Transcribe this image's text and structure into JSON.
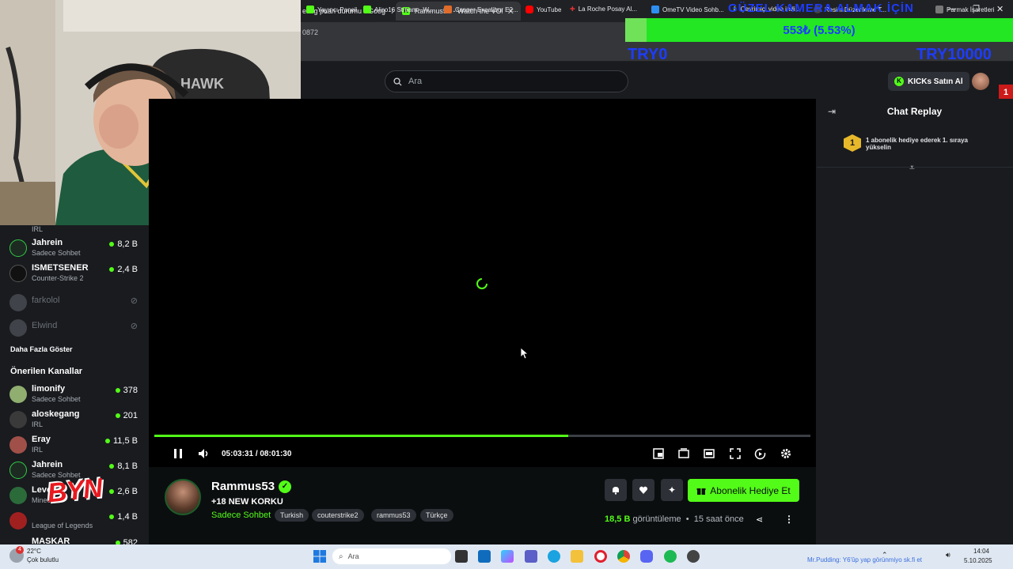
{
  "browser": {
    "tabs": [
      {
        "label": "er lig puan durumu - Goog"
      },
      {
        "label": "Rammus53 - Watch the VOD o"
      }
    ],
    "url_fragment": "0872",
    "bookmarks": [
      "Yayıncı Paneli",
      "Alico16 Stream - W...",
      "Casper Excalibur E2...",
      "YouTube",
      "La Roche Posay Al...",
      "OmeTV Video Sohb...",
      "Çevrimiçi video indi...",
      "Resim Düzenleme T...",
      "Parmak İşaretleri"
    ]
  },
  "header": {
    "search_placeholder": "Ara",
    "kicks_label": "KICKs Satın Al",
    "notification_count": "1"
  },
  "overlay": {
    "donation_title": "GÜZEL KAMERA ALMAK İÇİN",
    "donation_progress_text": "553₺ (5.53%)",
    "donation_progress": 0.0553,
    "left_label": "TRY0",
    "right_label": "TRY10000",
    "watermark": "BYN"
  },
  "sidebar": {
    "channels_top": [
      {
        "name": "",
        "category": "IRL",
        "viewers": ""
      },
      {
        "name": "Jahrein",
        "category": "Sadece Sohbet",
        "viewers": "8,2 B"
      },
      {
        "name": "ISMETSENER",
        "category": "Counter-Strike 2",
        "viewers": "2,4 B"
      },
      {
        "name": "farkolol",
        "category": "",
        "viewers": ""
      },
      {
        "name": "Elwind",
        "category": "",
        "viewers": ""
      }
    ],
    "show_more": "Daha Fazla Göster",
    "recommended_title": "Önerilen Kanallar",
    "recommended": [
      {
        "name": "limonify",
        "category": "Sadece Sohbet",
        "viewers": "378"
      },
      {
        "name": "aloskegang",
        "category": "IRL",
        "viewers": "201"
      },
      {
        "name": "Eray",
        "category": "IRL",
        "viewers": "11,5 B"
      },
      {
        "name": "Jahrein",
        "category": "Sadece Sohbet",
        "viewers": "8,1 B"
      },
      {
        "name": "Levo",
        "category": "Minecraft",
        "viewers": "2,6 B"
      },
      {
        "name": "",
        "category": "League of Legends",
        "viewers": "1,4 B"
      },
      {
        "name": "MASKAR",
        "category": "",
        "viewers": "582"
      }
    ]
  },
  "player": {
    "current_time": "05:03:31",
    "separator": "/",
    "duration": "08:01:30",
    "progress": 0.631
  },
  "chat": {
    "title": "Chat Replay",
    "gift_badge": "1",
    "gift_text": "1 abonelik hediye ederek 1. sıraya yükselin"
  },
  "stream": {
    "streamer": "Rammus53",
    "title": "+18 NEW KORKU",
    "category": "Sadece Sohbet",
    "tags": [
      "Turkish",
      "couterstrike2",
      "rammus53",
      "Türkçe"
    ],
    "gift_button": "Abonelik Hediye Et",
    "views_count": "18,5 B",
    "views_label": "görüntüleme",
    "dot": "•",
    "time_ago": "15 saat önce"
  },
  "taskbar": {
    "weather_temp": "22°C",
    "weather_desc": "Çok bulutlu",
    "search_placeholder": "Ara",
    "ticker": "Mr.Pudding: Y6'ûp yap görünmiyo sk.fi et",
    "time": "14:04",
    "date": "5.10.2025",
    "weather_badge": "4"
  }
}
